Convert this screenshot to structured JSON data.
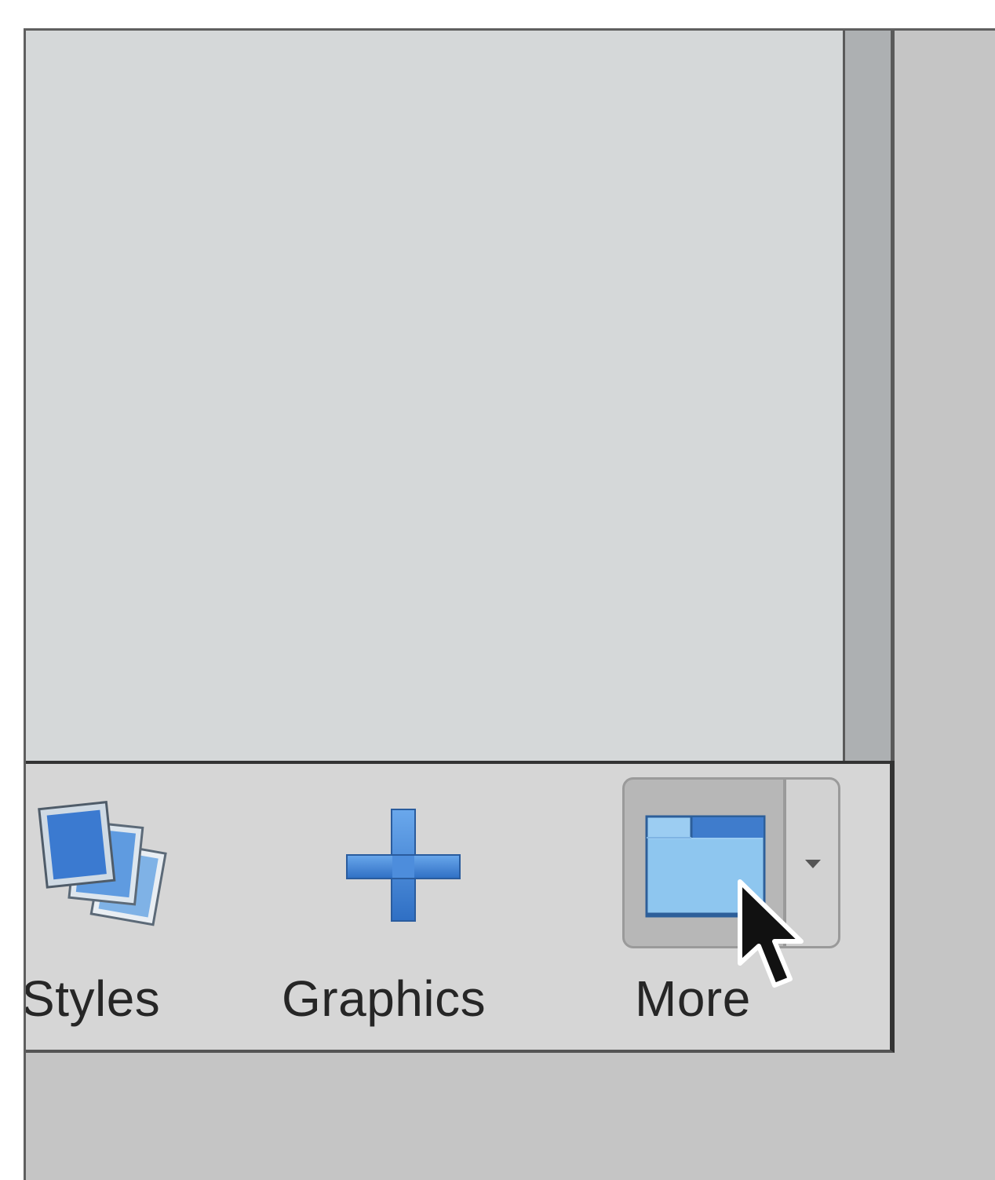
{
  "toolbar": {
    "styles_label": "Styles",
    "graphics_label": "Graphics",
    "more_label": "More"
  },
  "icons": {
    "styles": "styles-stack-icon",
    "graphics": "plus-icon",
    "more": "folder-icon",
    "dropdown": "chevron-down-icon",
    "cursor": "pointer-cursor-icon"
  },
  "colors": {
    "content_background": "#d5d8d9",
    "toolbar_background": "#d6d6d6",
    "icon_blue": "#4a86d8",
    "icon_light_blue": "#8cc4f0"
  }
}
